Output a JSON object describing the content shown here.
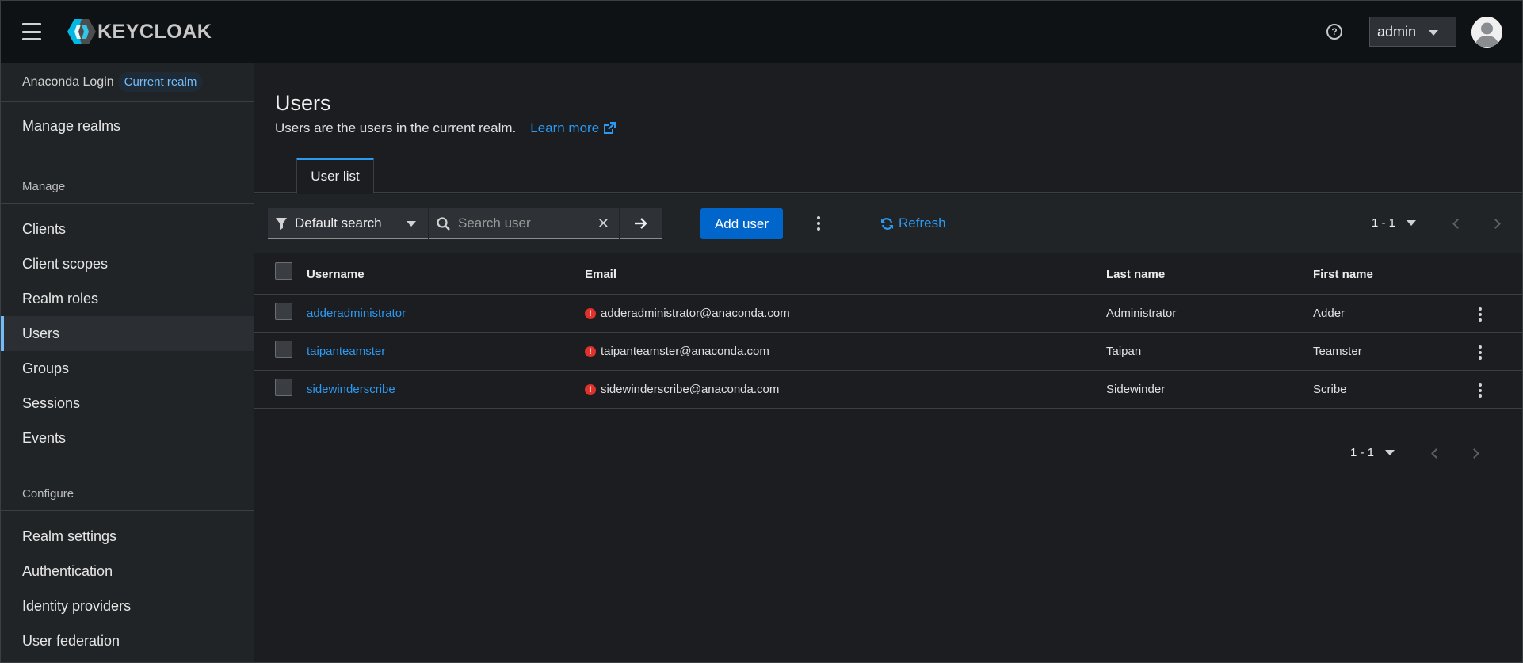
{
  "masthead": {
    "logo_text": "KEYCLOAK",
    "user_menu_label": "admin"
  },
  "sidebar": {
    "realm_name": "Anaconda Login",
    "realm_badge": "Current realm",
    "manage_realms": "Manage realms",
    "section_manage": "Manage",
    "manage_items": [
      {
        "label": "Clients"
      },
      {
        "label": "Client scopes"
      },
      {
        "label": "Realm roles"
      },
      {
        "label": "Users"
      },
      {
        "label": "Groups"
      },
      {
        "label": "Sessions"
      },
      {
        "label": "Events"
      }
    ],
    "active_item": "Users",
    "section_configure": "Configure",
    "configure_items": [
      {
        "label": "Realm settings"
      },
      {
        "label": "Authentication"
      },
      {
        "label": "Identity providers"
      },
      {
        "label": "User federation"
      }
    ]
  },
  "page": {
    "title": "Users",
    "description": "Users are the users in the current realm.",
    "learn_more": "Learn more",
    "tabs": [
      {
        "label": "User list"
      }
    ]
  },
  "toolbar": {
    "filter_label": "Default search",
    "search_placeholder": "Search user",
    "add_user_label": "Add user",
    "refresh_label": "Refresh",
    "pagination_range": "1 - 1"
  },
  "table": {
    "columns": [
      "Username",
      "Email",
      "Last name",
      "First name"
    ],
    "rows": [
      {
        "username": "adderadministrator",
        "email": "adderadministrator@anaconda.com",
        "last_name": "Administrator",
        "first_name": "Adder"
      },
      {
        "username": "taipanteamster",
        "email": "taipanteamster@anaconda.com",
        "last_name": "Taipan",
        "first_name": "Teamster"
      },
      {
        "username": "sidewinderscribe",
        "email": "sidewinderscribe@anaconda.com",
        "last_name": "Sidewinder",
        "first_name": "Scribe"
      }
    ],
    "email_warning_icon": "exclamation-circle-icon",
    "pagination_range": "1 - 1"
  },
  "colors": {
    "accent": "#2b9af3",
    "primary_button": "#0066cc",
    "warning": "#e0322d",
    "masthead_bg": "#0f1214",
    "page_bg": "#1b1d21"
  }
}
